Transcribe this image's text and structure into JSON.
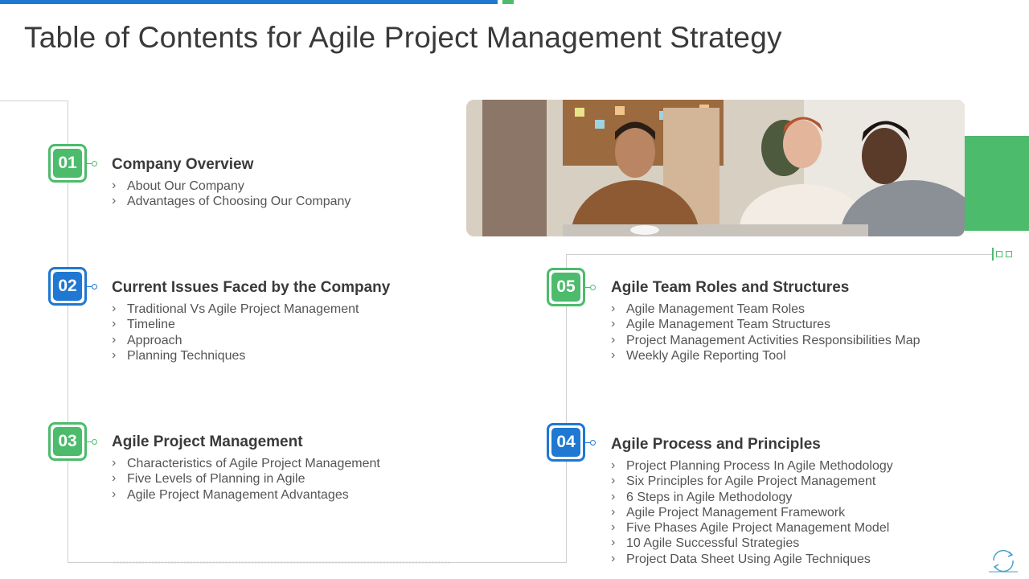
{
  "page": {
    "title": "Table of Contents for Agile Project Management Strategy"
  },
  "colors": {
    "accent_green": "#4cbb6c",
    "accent_blue": "#1f78d1",
    "text": "#3a3a3a"
  },
  "sections": [
    {
      "number": "01",
      "title": "Company Overview",
      "items": [
        "About Our Company",
        "Advantages of Choosing Our Company"
      ]
    },
    {
      "number": "02",
      "title": "Current Issues Faced by the Company",
      "items": [
        "Traditional Vs Agile Project Management",
        "Timeline",
        "Approach",
        "Planning Techniques"
      ]
    },
    {
      "number": "03",
      "title": "Agile Project Management",
      "items": [
        "Characteristics of Agile Project Management",
        "Five Levels of Planning in Agile",
        "Agile Project Management Advantages"
      ]
    },
    {
      "number": "04",
      "title": "Agile Process and Principles",
      "items": [
        "Project Planning Process In Agile Methodology",
        "Six Principles for Agile Project Management",
        "6 Steps in Agile Methodology",
        "Agile Project Management Framework",
        "Five Phases Agile Project Management Model",
        "10 Agile Successful Strategies",
        "Project Data Sheet Using Agile Techniques"
      ]
    },
    {
      "number": "05",
      "title": "Agile Team Roles and Structures",
      "items": [
        "Agile Management Team Roles",
        "Agile Management Team Structures",
        "Project Management Activities Responsibilities Map",
        "Weekly Agile Reporting Tool"
      ]
    }
  ],
  "icons": {
    "photo": "team-meeting-photo",
    "footer": "cycle-arrows-icon"
  }
}
